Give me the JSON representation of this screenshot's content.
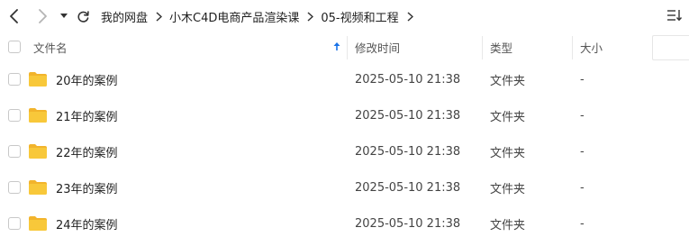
{
  "breadcrumb": {
    "items": [
      "我的网盘",
      "小木C4D电商产品渲染课",
      "05-视频和工程"
    ]
  },
  "table": {
    "columns": {
      "name": "文件名",
      "modified": "修改时间",
      "type": "类型",
      "size": "大小"
    },
    "rows": [
      {
        "name": "20年的案例",
        "modified": "2025-05-10 21:38",
        "type": "文件夹",
        "size": "-"
      },
      {
        "name": "21年的案例",
        "modified": "2025-05-10 21:38",
        "type": "文件夹",
        "size": "-"
      },
      {
        "name": "22年的案例",
        "modified": "2025-05-10 21:38",
        "type": "文件夹",
        "size": "-"
      },
      {
        "name": "23年的案例",
        "modified": "2025-05-10 21:38",
        "type": "文件夹",
        "size": "-"
      },
      {
        "name": "24年的案例",
        "modified": "2025-05-10 21:38",
        "type": "文件夹",
        "size": "-"
      }
    ]
  },
  "colors": {
    "accent": "#1a73e8",
    "folder": "#f8c83a",
    "folder_tab": "#f2b42c"
  },
  "icons": [
    "back-arrow-icon",
    "forward-arrow-icon",
    "history-dropdown-icon",
    "refresh-icon",
    "breadcrumb-chevron-icon",
    "sort-asc-icon",
    "folder-icon",
    "view-mode-icon"
  ]
}
